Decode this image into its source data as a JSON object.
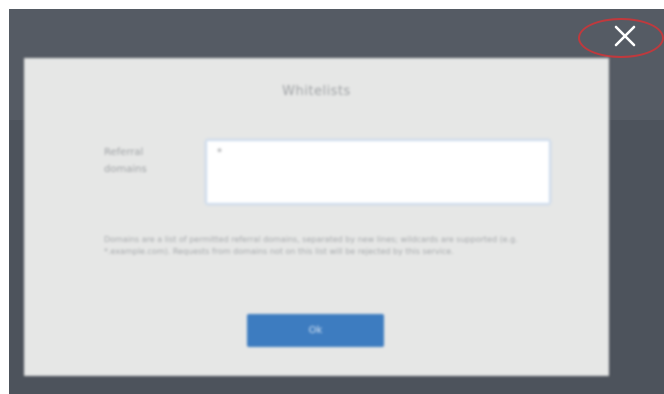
{
  "overlay": {
    "close_icon": "close-icon",
    "close_highlight_color": "#c0393d"
  },
  "dialog": {
    "title": "Whitelists",
    "field_label": "Referral domains",
    "field_value": "*",
    "help_text": "Domains are a list of permitted referral domains, separated by new lines; wildcards are supported (e.g. *.example.com). Requests from domains not on this list will be rejected by this service.",
    "ok_label": "Ok",
    "accent_color": "#3d7cc0"
  }
}
